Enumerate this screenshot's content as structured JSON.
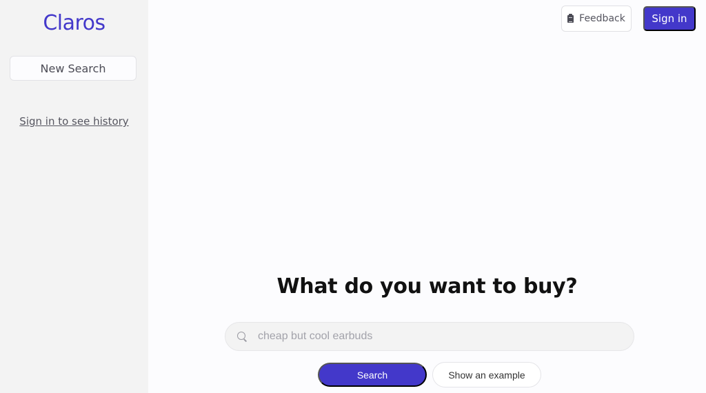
{
  "sidebar": {
    "brand": "Claros",
    "new_search_label": "New Search",
    "history_link": "Sign in to see history"
  },
  "header": {
    "feedback_label": "Feedback",
    "feedback_icon": "clipboard-icon",
    "signin_label": "Sign in"
  },
  "main": {
    "headline": "What do you want to buy?",
    "search": {
      "icon": "search-icon",
      "value": "",
      "placeholder": "cheap but cool earbuds"
    },
    "search_button": "Search",
    "example_button": "Show an example"
  },
  "colors": {
    "accent": "#4338ca",
    "sidebar_bg": "#f3f3f3",
    "page_bg": "#fcfcfe"
  }
}
